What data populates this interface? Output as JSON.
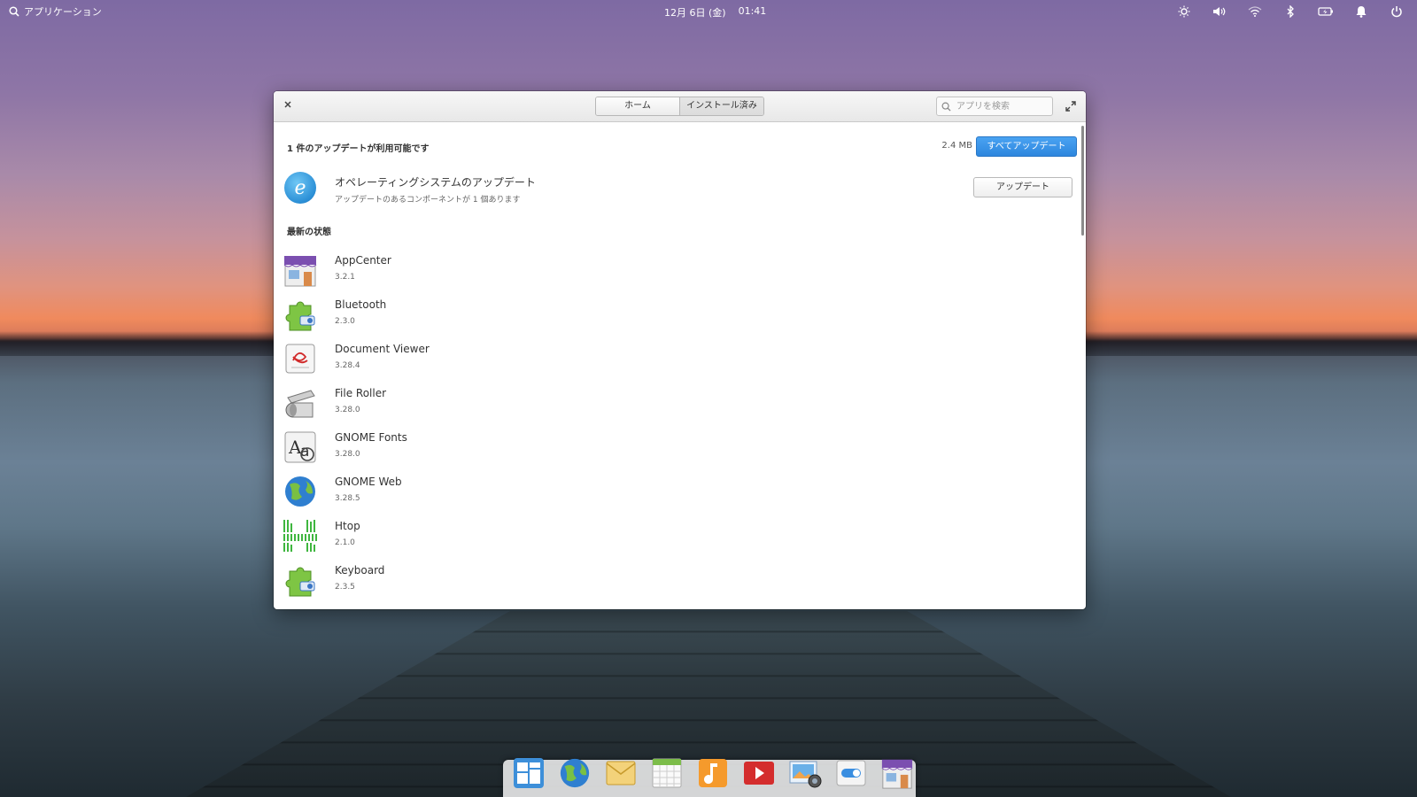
{
  "panel": {
    "applications_label": "アプリケーション",
    "date": "12月 6日 (金)",
    "time": "01:41"
  },
  "window": {
    "tabs": [
      "ホーム",
      "インストール済み"
    ],
    "search_placeholder": "アプリを検索",
    "updates": {
      "header": "1 件のアップデートが利用可能です",
      "size": "2.4 MB",
      "update_all_label": "すべてアップデート",
      "os": {
        "title": "オペレーティングシステムのアップデート",
        "subtitle": "アップデートのあるコンポーネントが 1 個あります",
        "button_label": "アップデート"
      }
    },
    "latest_header": "最新の状態",
    "apps": [
      {
        "name": "AppCenter",
        "version": "3.2.1",
        "icon": "appcenter-icon"
      },
      {
        "name": "Bluetooth",
        "version": "2.3.0",
        "icon": "bluetooth-plug-icon"
      },
      {
        "name": "Document Viewer",
        "version": "3.28.4",
        "icon": "document-viewer-icon"
      },
      {
        "name": "File Roller",
        "version": "3.28.0",
        "icon": "file-roller-icon"
      },
      {
        "name": "GNOME Fonts",
        "version": "3.28.0",
        "icon": "fonts-icon"
      },
      {
        "name": "GNOME Web",
        "version": "3.28.5",
        "icon": "web-browser-icon"
      },
      {
        "name": "Htop",
        "version": "2.1.0",
        "icon": "htop-icon"
      },
      {
        "name": "Keyboard",
        "version": "2.3.5",
        "icon": "keyboard-plug-icon"
      }
    ]
  },
  "dock": [
    "multitasking-view-icon",
    "web-browser-icon",
    "mail-icon",
    "calendar-icon",
    "music-icon",
    "videos-icon",
    "photos-icon",
    "settings-icon",
    "appcenter-icon"
  ],
  "colors": {
    "accent": "#3a93e6"
  }
}
